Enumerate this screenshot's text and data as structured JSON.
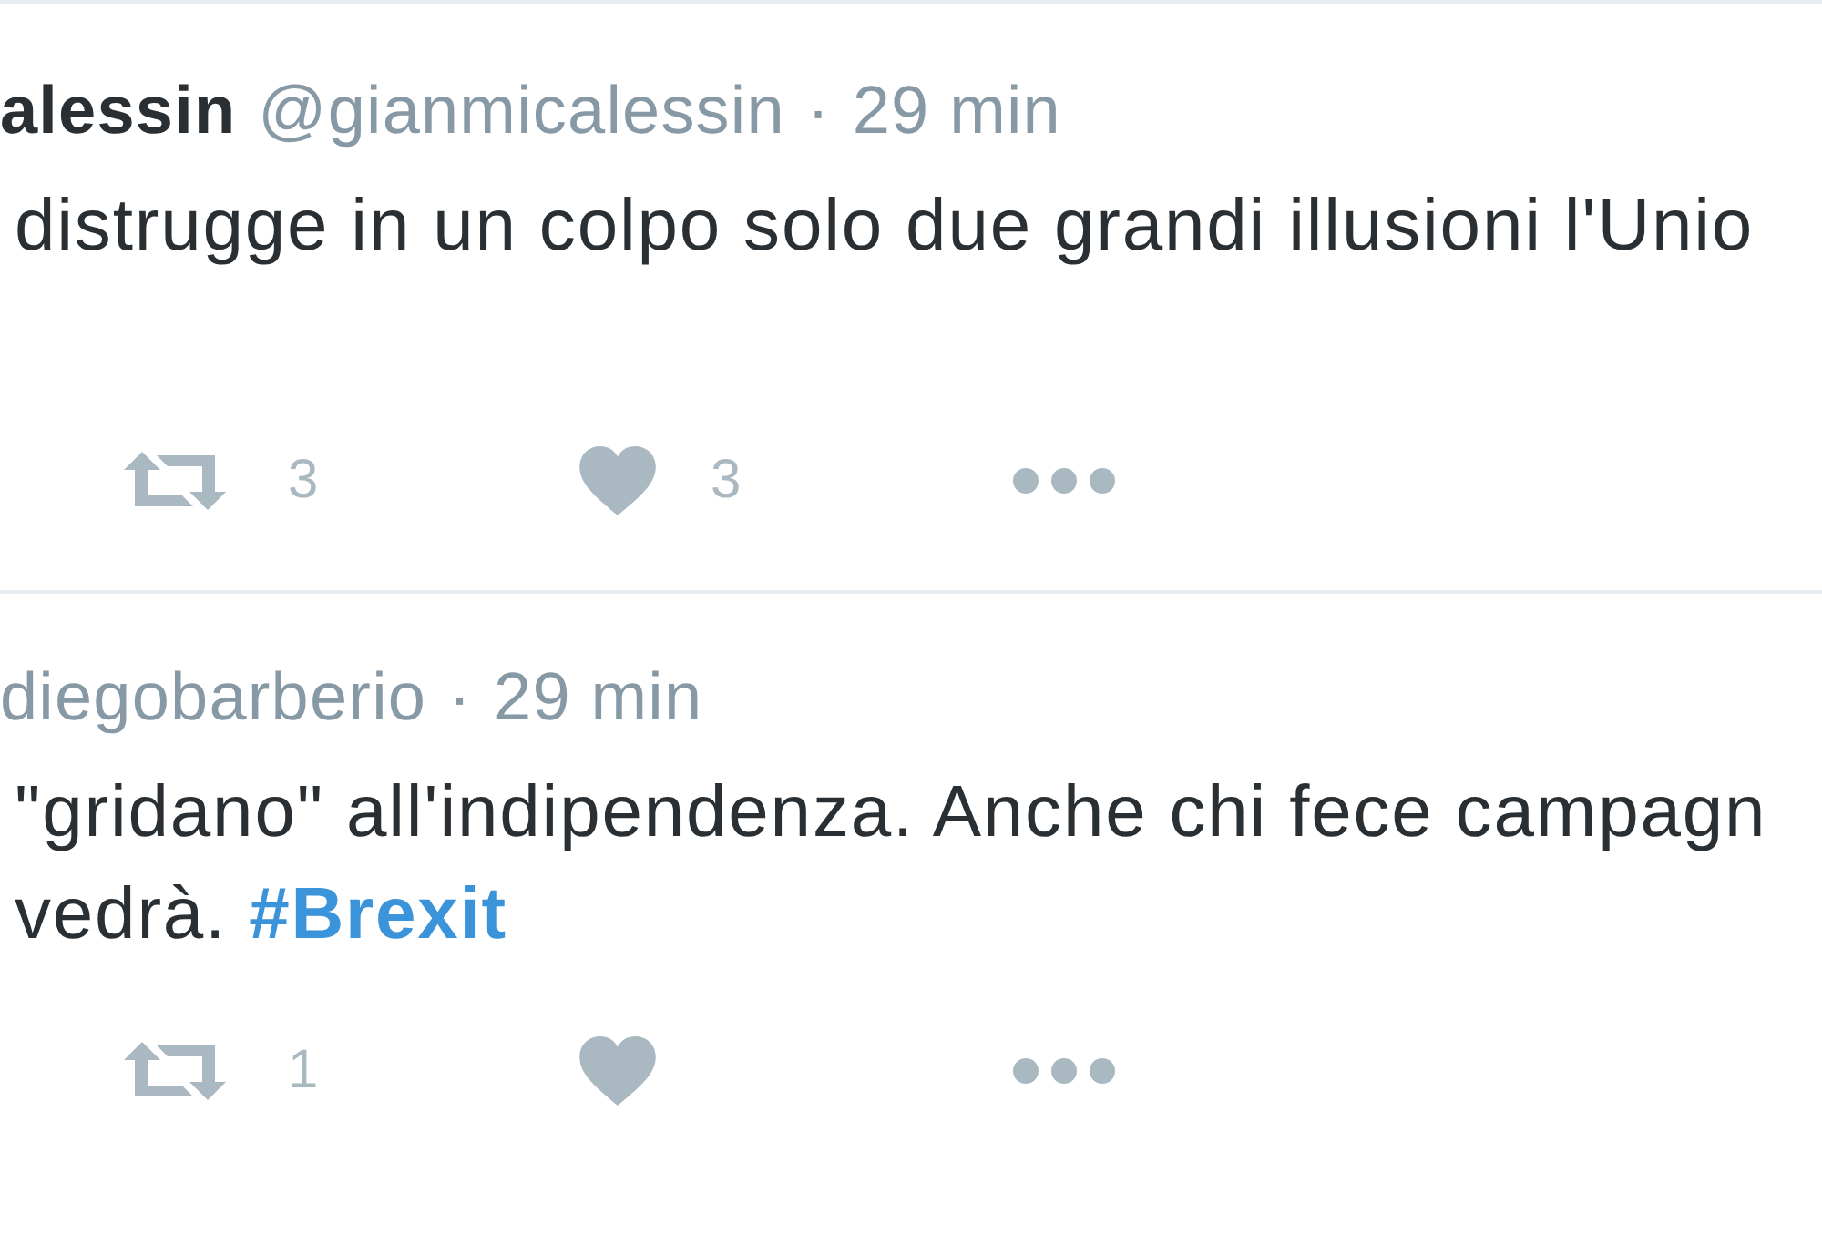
{
  "tweets": [
    {
      "name": "alessin",
      "handle": "@gianmicalessin",
      "separator": "·",
      "time": "29 min",
      "body_lines": [
        "distrugge in un colpo solo due grandi illusioni l'Unio"
      ],
      "retweets": "3",
      "likes": "3"
    },
    {
      "handle": "diegobarberio",
      "separator": "·",
      "time": "29 min",
      "body_lines": [
        "\"gridano\" all'indipendenza. Anche chi fece campagn",
        "vedrà."
      ],
      "hashtag": "#Brexit",
      "retweets": "1"
    }
  ]
}
